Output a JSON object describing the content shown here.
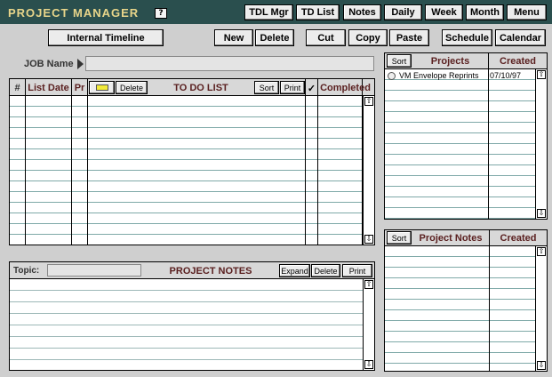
{
  "app": {
    "title": "PROJECT MANAGER",
    "help_label": "?"
  },
  "header_nav": {
    "tdl_mgr": "TDL Mgr",
    "td_list": "TD List",
    "notes": "Notes",
    "daily": "Daily",
    "week": "Week",
    "month": "Month",
    "menu": "Menu"
  },
  "toolbar": {
    "internal_timeline": "Internal Timeline",
    "new": "New",
    "delete": "Delete",
    "cut": "Cut",
    "copy": "Copy",
    "paste": "Paste",
    "schedule": "Schedule",
    "calendar": "Calendar"
  },
  "job": {
    "label": "JOB Name",
    "value": ""
  },
  "todo": {
    "col_num": "#",
    "col_list_date": "List Date",
    "col_priority": "Pr",
    "delete": "Delete",
    "title": "TO DO LIST",
    "sort": "Sort",
    "print": "Print",
    "check": "✓",
    "col_completed": "Completed",
    "swatch_color": "#f2ea3a"
  },
  "notes": {
    "topic_label": "Topic:",
    "topic_value": "",
    "title": "PROJECT NOTES",
    "expand": "Expand",
    "delete": "Delete",
    "print": "Print"
  },
  "projects": {
    "sort": "Sort",
    "col_projects": "Projects",
    "col_created": "Created",
    "rows": [
      {
        "name": "VM Envelope Reprints",
        "created": "07/10/97"
      }
    ]
  },
  "project_notes_list": {
    "sort": "Sort",
    "col_project_notes": "Project Notes",
    "col_created": "Created"
  },
  "colors": {
    "header_bg": "#2a4f4e",
    "title_text": "#e8d58a",
    "heading_text": "#5a2020",
    "row_line": "#7fa9a8"
  }
}
